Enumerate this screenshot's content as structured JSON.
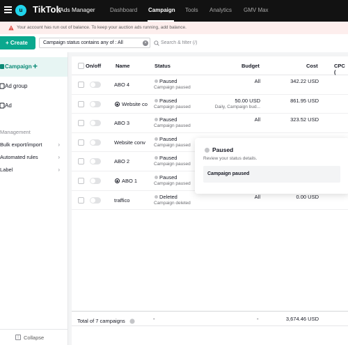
{
  "app": {
    "avatar_letter": "u",
    "brand": "TikTok",
    "brand_sub": "Ads Manager",
    "accent_color": "#0aa88e"
  },
  "nav": {
    "items": [
      {
        "label": "Dashboard",
        "active": false
      },
      {
        "label": "Campaign",
        "active": true
      },
      {
        "label": "Tools",
        "active": false
      },
      {
        "label": "Analytics",
        "active": false
      },
      {
        "label": "GMV Max",
        "active": false
      }
    ]
  },
  "alert": {
    "text": "Your account has run out of balance. To keep your auction ads running, add balance."
  },
  "toolbar": {
    "create_label": "Create",
    "filter_text": "Campaign status contains any of : All",
    "search_placeholder": "Search & filter (/)"
  },
  "sidebar": {
    "items": [
      {
        "label": "Campaign",
        "active": true
      },
      {
        "label": "Ad group",
        "active": false
      },
      {
        "label": "Ad",
        "active": false
      }
    ],
    "section_title": "Management",
    "management": [
      {
        "label": "Bulk export/import"
      },
      {
        "label": "Automated rules"
      },
      {
        "label": "Label"
      }
    ],
    "collapse_label": "Collapse"
  },
  "table": {
    "headers": {
      "onoff": "On/off",
      "name": "Name",
      "status": "Status",
      "budget": "Budget",
      "cost": "Cost",
      "cpc": "CPC ("
    },
    "rows": [
      {
        "name": "ABO 4",
        "smart": false,
        "status": "Paused",
        "status_sub": "Campaign paused",
        "budget": "All",
        "budget_sub": "",
        "cost": "342.22 USD"
      },
      {
        "name": "Website co",
        "smart": true,
        "status": "Paused",
        "status_sub": "Campaign paused",
        "budget": "50.00 USD",
        "budget_sub": "Daily, Campaign bud...",
        "cost": "861.95 USD"
      },
      {
        "name": "ABO 3",
        "smart": false,
        "status": "Paused",
        "status_sub": "Campaign paused",
        "budget": "All",
        "budget_sub": "",
        "cost": "323.52 USD"
      },
      {
        "name": "Website conv",
        "smart": false,
        "status": "Paused",
        "status_sub": "Campaign paused",
        "budget": "",
        "budget_sub": "",
        "cost": ""
      },
      {
        "name": "ABO 2",
        "smart": false,
        "status": "Paused",
        "status_sub": "Campaign paused",
        "budget": "",
        "budget_sub": "",
        "cost": ""
      },
      {
        "name": "ABO 1",
        "smart": true,
        "status": "Paused",
        "status_sub": "Campaign paused",
        "budget": "",
        "budget_sub": "",
        "cost": ""
      },
      {
        "name": "traffico",
        "smart": false,
        "status": "Deleted",
        "status_sub": "Campaign deleted",
        "budget": "All",
        "budget_sub": "",
        "cost": "0.00 USD"
      }
    ],
    "footer": {
      "label": "Total of 7 campaigns",
      "status": "-",
      "budget": "-",
      "cost": "3,674.46 USD"
    }
  },
  "popover": {
    "title": "Paused",
    "subtitle": "Review your status details.",
    "box_text": "Campaign paused"
  }
}
